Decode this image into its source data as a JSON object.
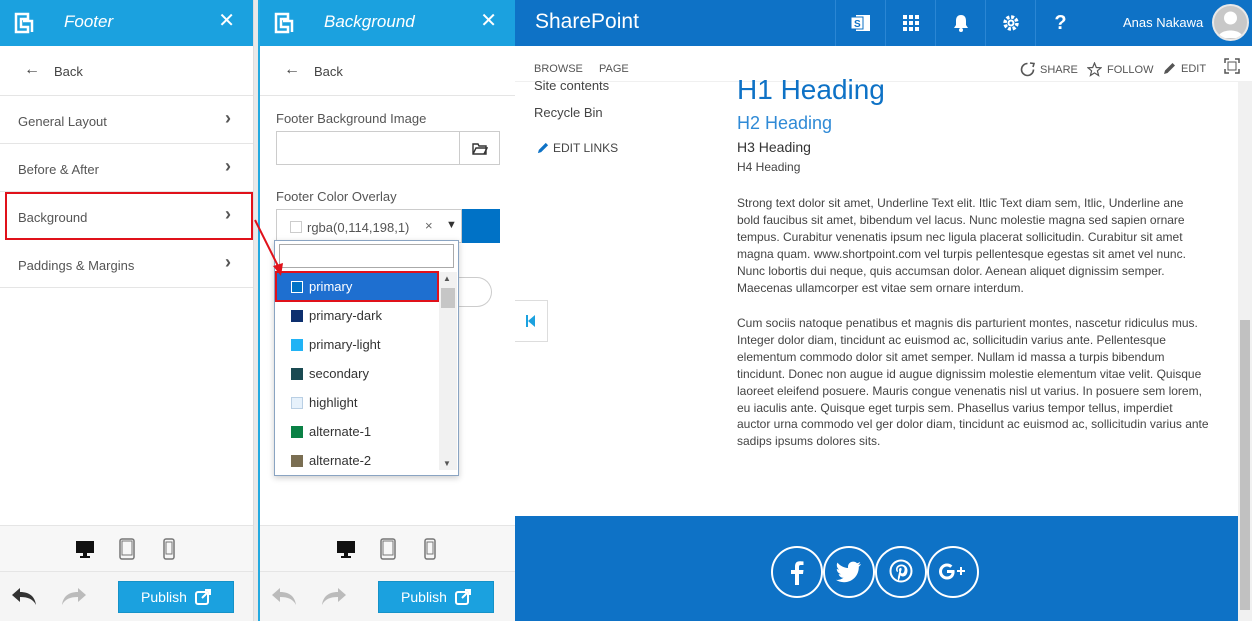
{
  "panel1": {
    "title": "Footer",
    "back_label": "Back",
    "menu": [
      {
        "label": "General Layout"
      },
      {
        "label": "Before & After"
      },
      {
        "label": "Background"
      },
      {
        "label": "Paddings & Margins"
      }
    ],
    "publish_label": "Publish"
  },
  "panel2": {
    "title": "Background",
    "back_label": "Back",
    "bg_image_label": "Footer Background Image",
    "bg_image_value": "",
    "color_overlay_label": "Footer Color Overlay",
    "color_overlay_value": "rgba(0,114,198,1)",
    "clear_label": "×",
    "overlay_preview_color": "#0072c6",
    "publish_label": "Publish",
    "dropdown": {
      "search_value": "",
      "options": [
        {
          "label": "primary",
          "color": "#0072c6",
          "selected": true
        },
        {
          "label": "primary-dark",
          "color": "#0d2f6e"
        },
        {
          "label": "primary-light",
          "color": "#21b3f5"
        },
        {
          "label": "secondary",
          "color": "#1a4a52"
        },
        {
          "label": "highlight",
          "color": "#e6f1fb"
        },
        {
          "label": "alternate-1",
          "color": "#0a8145"
        },
        {
          "label": "alternate-2",
          "color": "#7a6e52"
        }
      ]
    }
  },
  "sharepoint": {
    "brand": "SharePoint",
    "user_name": "Anas Nakawa",
    "ribbon_tabs": [
      "BROWSE",
      "PAGE"
    ],
    "ribbon_actions": [
      "SHARE",
      "FOLLOW",
      "EDIT"
    ],
    "quick_links": [
      "Site contents",
      "Recycle Bin"
    ],
    "edit_links_label": "EDIT LINKS",
    "h1": "H1 Heading",
    "h2": "H2 Heading",
    "h3": "H3 Heading",
    "h4": "H4 Heading",
    "paragraph1": "Strong text dolor sit amet, Underline Text elit. Itlic Text diam sem, Itlic, Underline ane bold faucibus sit amet, bibendum vel lacus. Nunc molestie magna sed sapien ornare tempus. Curabitur venenatis ipsum nec ligula placerat sollicitudin. Curabitur sit amet magna quam. www.shortpoint.com vel turpis pellentesque egestas sit amet vel nunc. Nunc lobortis dui neque, quis accumsan dolor. Aenean aliquet dignissim semper. Maecenas ullamcorper est vitae sem ornare interdum.",
    "paragraph2": "Cum sociis natoque penatibus et magnis dis parturient montes, nascetur ridiculus mus. Integer dolor diam, tincidunt ac euismod ac, sollicitudin varius ante. Pellentesque elementum commodo dolor sit amet semper. Nullam id massa a turpis bibendum tincidunt. Donec non augue id augue dignissim molestie elementum vitae velit. Quisque laoreet eleifend posuere. Mauris congue venenatis nisl ut varius. In posuere sem lorem, eu iaculis ante. Quisque eget turpis sem. Phasellus varius tempor tellus, imperdiet auctor urna commodo vel ger dolor diam, tincidunt ac euismod ac, sollicitudin varius ante sadips ipsums dolores sits.",
    "footer_color": "#0e72c6",
    "social_icons": [
      "facebook-icon",
      "twitter-icon",
      "pinterest-icon",
      "google-plus-icon"
    ]
  },
  "colors": {
    "panel_header": "#1ba1df",
    "highlight_outline": "#e0111a",
    "sharepoint_blue": "#0e72c6"
  }
}
